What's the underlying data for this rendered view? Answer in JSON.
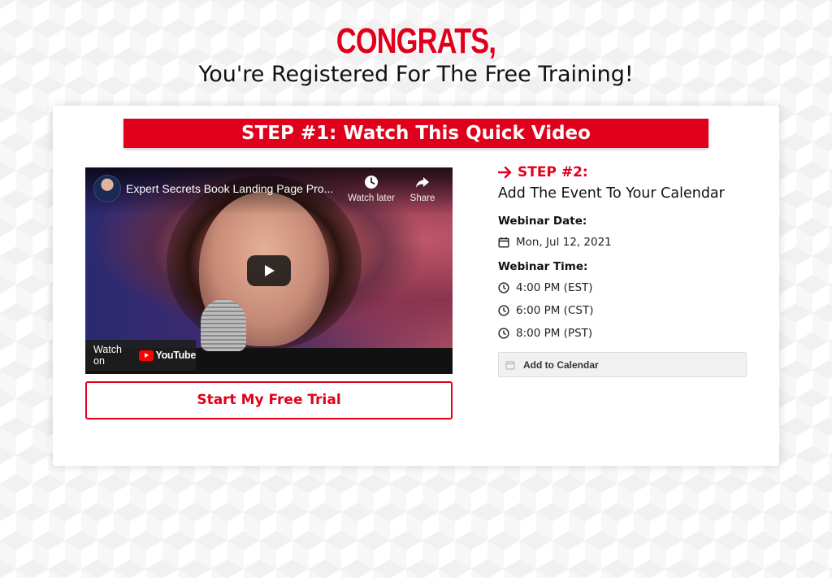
{
  "header": {
    "headline": "CONGRATS,",
    "subheadline": "You're Registered For The Free Training!"
  },
  "step1": {
    "banner": "STEP #1: Watch This Quick Video"
  },
  "video": {
    "title": "Expert Secrets Book Landing Page Pro...",
    "watch_later": "Watch later",
    "share": "Share",
    "watch_on": "Watch on",
    "youtube_brand": "YouTube"
  },
  "cta": {
    "label": "Start My Free Trial"
  },
  "step2": {
    "title": "STEP #2:",
    "subtitle": "Add The Event To Your Calendar",
    "date_label": "Webinar Date:",
    "date_value": "Mon, Jul 12, 2021",
    "time_label": "Webinar Time:",
    "times": [
      "4:00 PM (EST)",
      "6:00 PM (CST)",
      "8:00 PM (PST)"
    ],
    "add_to_calendar": "Add to Calendar"
  },
  "colors": {
    "accent": "#e0001b",
    "text": "#111111"
  }
}
